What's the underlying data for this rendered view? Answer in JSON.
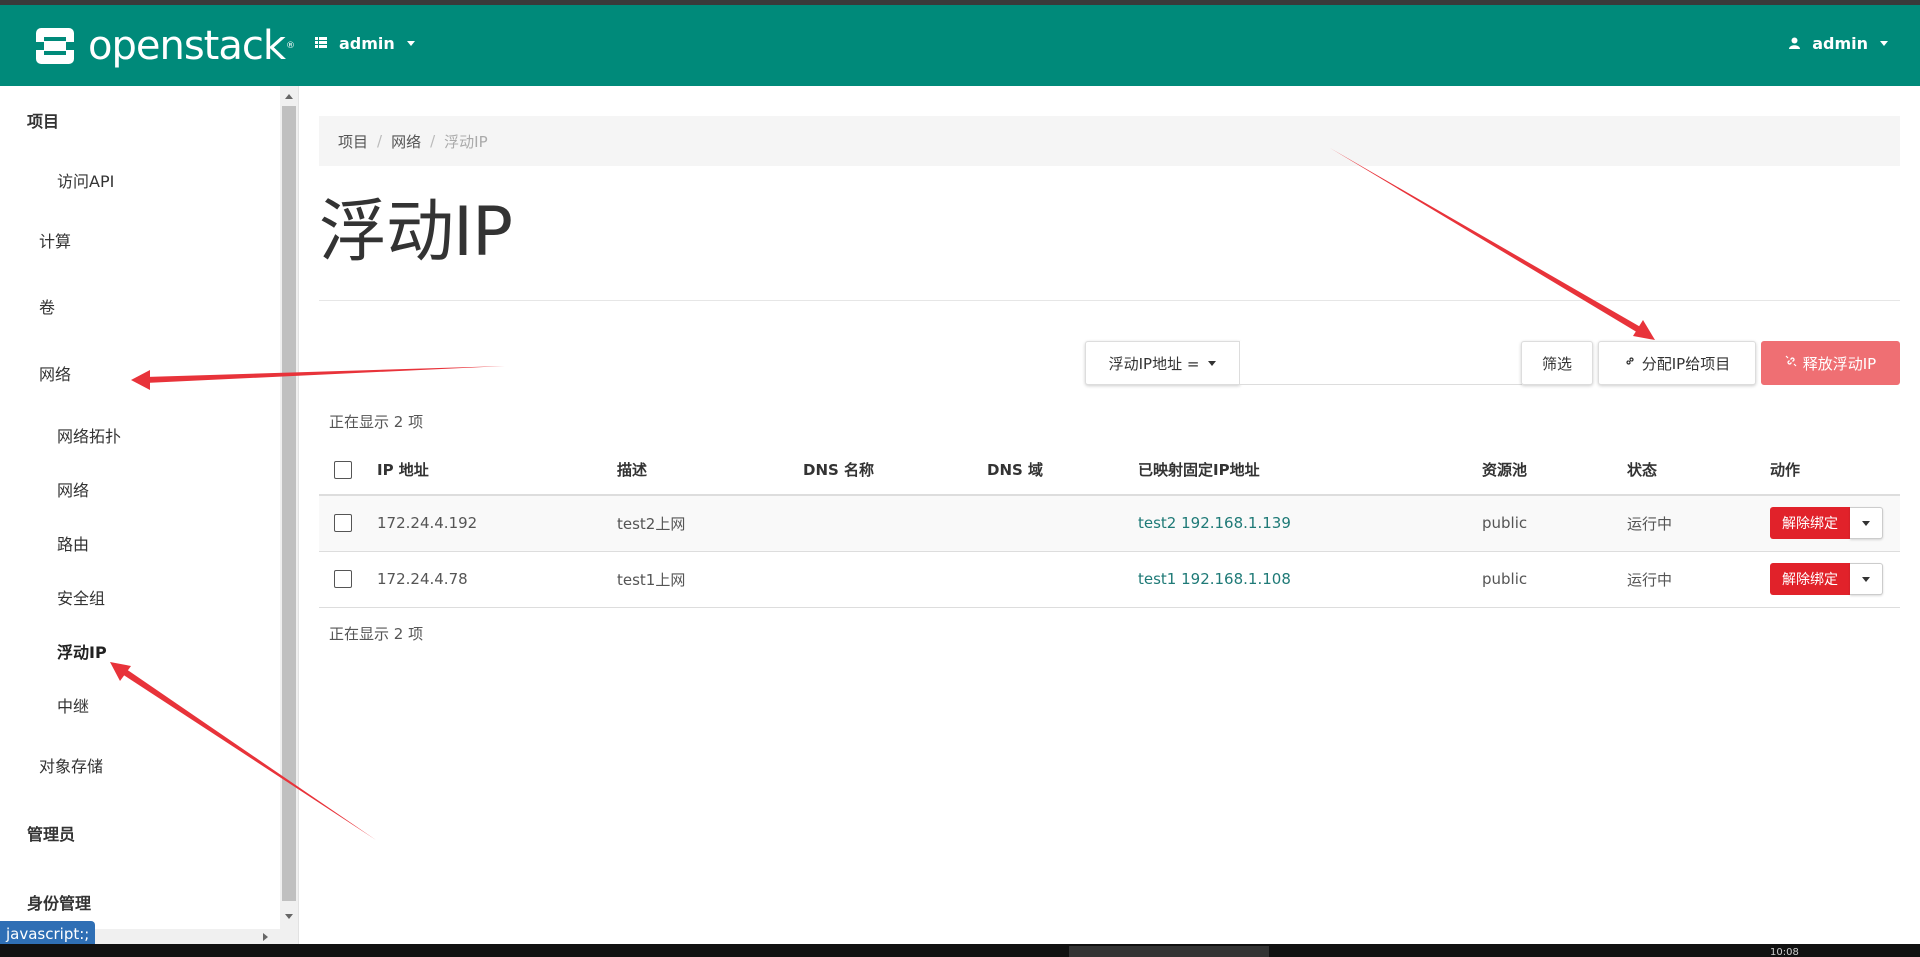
{
  "header": {
    "logo_text": "openstack",
    "logo_reg": "®",
    "project_selector": "admin",
    "user_menu": "admin"
  },
  "sidebar": {
    "items": [
      {
        "label": "项目",
        "level": 1
      },
      {
        "label": "访问API",
        "level": 3
      },
      {
        "label": "计算",
        "level": 2
      },
      {
        "label": "卷",
        "level": 2
      },
      {
        "label": "网络",
        "level": 2
      },
      {
        "label": "网络拓扑",
        "level": 3
      },
      {
        "label": "网络",
        "level": 3
      },
      {
        "label": "路由",
        "level": 3
      },
      {
        "label": "安全组",
        "level": 3
      },
      {
        "label": "浮动IP",
        "level": 3,
        "active": true
      },
      {
        "label": "中继",
        "level": 3
      },
      {
        "label": "对象存储",
        "level": 2
      },
      {
        "label": "管理员",
        "level": 1
      },
      {
        "label": "身份管理",
        "level": 1
      }
    ]
  },
  "status_tip": "javascript:;",
  "taskbar": {
    "clock": "10:08"
  },
  "breadcrumb": [
    "项目",
    "网络",
    "浮动IP"
  ],
  "page_title": "浮动IP",
  "toolbar": {
    "filter_field": "浮动IP地址 =",
    "filter_value": "",
    "filter_button": "筛选",
    "allocate_button": "分配IP给项目",
    "release_button": "释放浮动IP"
  },
  "table": {
    "count_top": "正在显示 2 项",
    "count_bottom": "正在显示 2 项",
    "columns": [
      "IP 地址",
      "描述",
      "DNS 名称",
      "DNS 域",
      "已映射固定IP地址",
      "资源池",
      "状态",
      "动作"
    ],
    "rows": [
      {
        "ip": "172.24.4.192",
        "desc": "test2上网",
        "dns_name": "",
        "dns_domain": "",
        "mapped": "test2 192.168.1.139",
        "pool": "public",
        "status": "运行中",
        "action": "解除绑定"
      },
      {
        "ip": "172.24.4.78",
        "desc": "test1上网",
        "dns_name": "",
        "dns_domain": "",
        "mapped": "test1 192.168.1.108",
        "pool": "public",
        "status": "运行中",
        "action": "解除绑定"
      }
    ]
  },
  "colors": {
    "header_bg": "#008a7a",
    "danger": "#e1222a",
    "danger_light": "#ef6f73",
    "link": "#1f7a77",
    "annotation_arrow": "#e8333a"
  }
}
